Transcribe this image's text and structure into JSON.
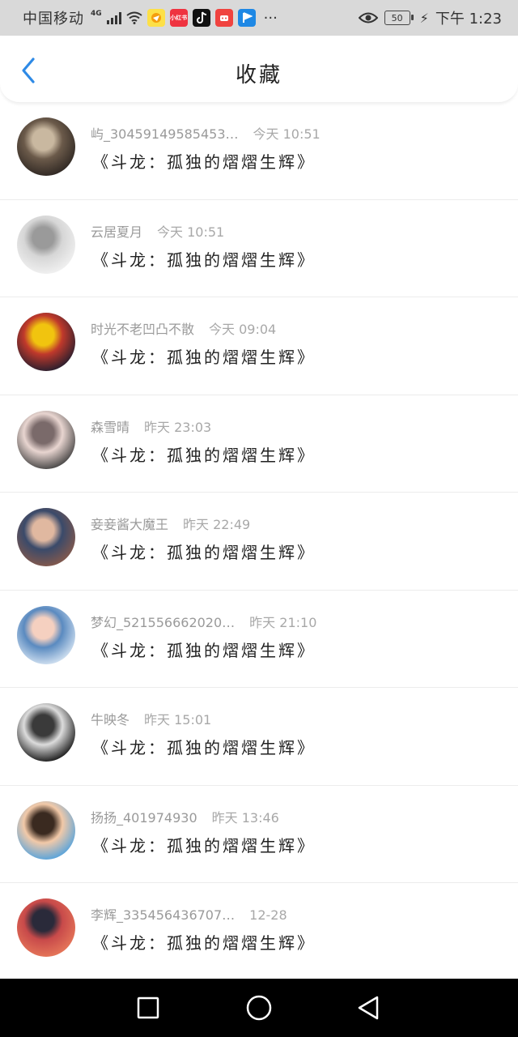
{
  "status_bar": {
    "carrier": "中国移动",
    "network": "4G",
    "battery": "50",
    "time": "下午 1:23",
    "more": "···",
    "app_icons": [
      {
        "name": "paper-plane-app-icon",
        "color": "#fde047"
      },
      {
        "name": "xiaohongshu-app-icon",
        "color": "#ef3340",
        "text": "小红书"
      },
      {
        "name": "tiktok-app-icon",
        "color": "#111111"
      },
      {
        "name": "pinduoduo-app-icon",
        "color": "#f0433f"
      },
      {
        "name": "flag-app-icon",
        "color": "#1e88e5"
      }
    ]
  },
  "header": {
    "title": "收藏",
    "back_icon": "chevron-left-icon",
    "accent": "#2e8ae6"
  },
  "favorites": [
    {
      "user": "屿_30459149585453…",
      "time": "今天  10:51",
      "book": "《斗龙：孤独的熠熠生辉》",
      "avatar_colors": [
        "#2b2420",
        "#6b5a4a",
        "#c9b8a0"
      ]
    },
    {
      "user": "云居夏月",
      "time": "今天  10:51",
      "book": "《斗龙：孤独的熠熠生辉》",
      "avatar_colors": [
        "#f3f3f3",
        "#d6d6d6",
        "#9a9a9a"
      ]
    },
    {
      "user": "时光不老凹凸不散",
      "time": "今天  09:04",
      "book": "《斗龙：孤独的熠熠生辉》",
      "avatar_colors": [
        "#1c1c2e",
        "#c0392b",
        "#f1c40f"
      ]
    },
    {
      "user": "森雪晴",
      "time": "昨天  23:03",
      "book": "《斗龙：孤独的熠熠生辉》",
      "avatar_colors": [
        "#3a3a3a",
        "#e8d5d0",
        "#7a6a6a"
      ]
    },
    {
      "user": "妾妾酱大魔王",
      "time": "昨天  22:49",
      "book": "《斗龙：孤独的熠熠生辉》",
      "avatar_colors": [
        "#8a5a4a",
        "#3a4a6a",
        "#e0b8a0"
      ]
    },
    {
      "user": "梦幻_521556662020…",
      "time": "昨天  21:10",
      "book": "《斗龙：孤独的熠熠生辉》",
      "avatar_colors": [
        "#dbe8f5",
        "#5a8ac0",
        "#f5d0c0"
      ]
    },
    {
      "user": "牛映冬",
      "time": "昨天  15:01",
      "book": "《斗龙：孤独的熠熠生辉》",
      "avatar_colors": [
        "#0a0a0a",
        "#dcdcdc",
        "#3a3a3a"
      ]
    },
    {
      "user": "扬扬_401974930",
      "time": "昨天  13:46",
      "book": "《斗龙：孤独的熠熠生辉》",
      "avatar_colors": [
        "#4aa0e0",
        "#f2c9a8",
        "#3a2a20"
      ]
    },
    {
      "user": "李辉_335456436707…",
      "time": "12-28",
      "book": "《斗龙：孤独的熠熠生辉》",
      "avatar_colors": [
        "#e87a5a",
        "#c84a4a",
        "#2a2a3a"
      ]
    }
  ],
  "nav": {
    "recent": "square-icon",
    "home": "circle-icon",
    "back": "triangle-back-icon"
  }
}
